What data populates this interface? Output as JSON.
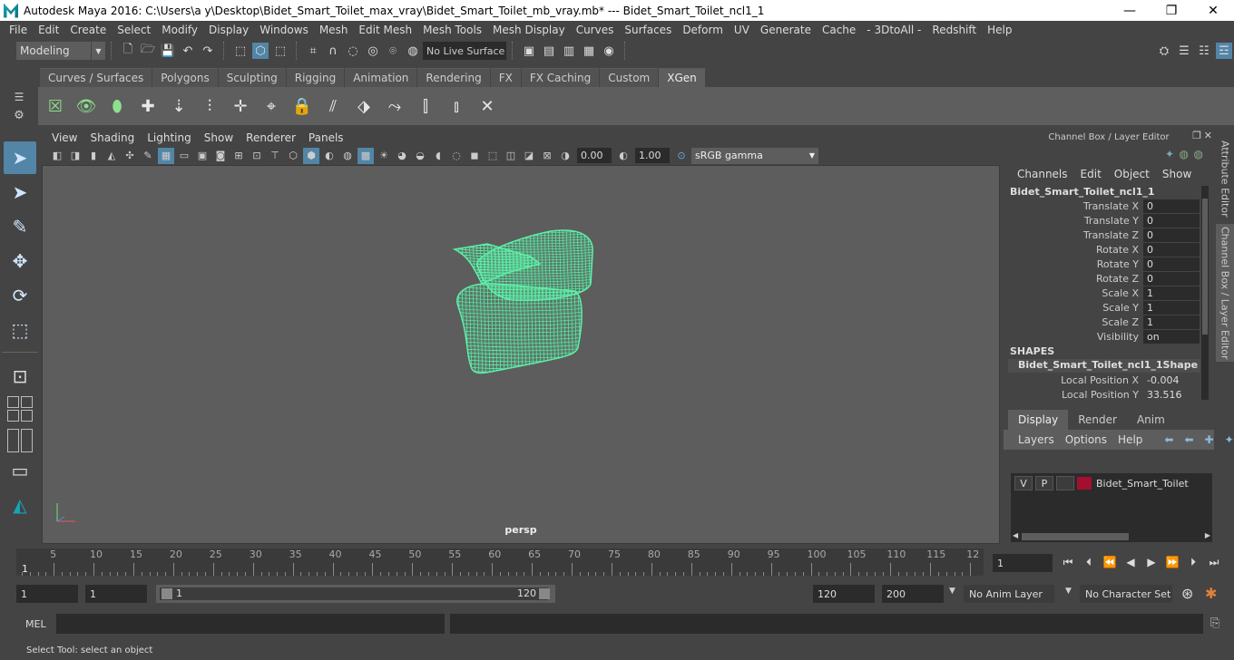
{
  "window": {
    "title": "Autodesk Maya 2016: C:\\Users\\a y\\Desktop\\Bidet_Smart_Toilet_max_vray\\Bidet_Smart_Toilet_mb_vray.mb*   ---   Bidet_Smart_Toilet_ncl1_1",
    "minimize": "—",
    "maximize": "❐",
    "close": "✕"
  },
  "menubar": [
    "File",
    "Edit",
    "Create",
    "Select",
    "Modify",
    "Display",
    "Windows",
    "Mesh",
    "Edit Mesh",
    "Mesh Tools",
    "Mesh Display",
    "Curves",
    "Surfaces",
    "Deform",
    "UV",
    "Generate",
    "Cache",
    "- 3DtoAll -",
    "Redshift",
    "Help"
  ],
  "statusline": {
    "mode": "Modeling",
    "live_surface": "No Live Surface"
  },
  "shelf": {
    "tabs": [
      "Curves / Surfaces",
      "Polygons",
      "Sculpting",
      "Rigging",
      "Animation",
      "Rendering",
      "FX",
      "FX Caching",
      "Custom",
      "XGen"
    ],
    "active_tab": "XGen"
  },
  "viewport": {
    "menu": [
      "View",
      "Shading",
      "Lighting",
      "Show",
      "Renderer",
      "Panels"
    ],
    "exposure": "0.00",
    "gamma": "1.00",
    "color_space": "sRGB gamma",
    "camera": "persp",
    "mesh_color": "#5cf0a8"
  },
  "channel_box": {
    "header": "Channel Box / Layer Editor",
    "menu": [
      "Channels",
      "Edit",
      "Object",
      "Show"
    ],
    "object": "Bidet_Smart_Toilet_ncl1_1",
    "attributes": [
      {
        "label": "Translate X",
        "value": "0"
      },
      {
        "label": "Translate Y",
        "value": "0"
      },
      {
        "label": "Translate Z",
        "value": "0"
      },
      {
        "label": "Rotate X",
        "value": "0"
      },
      {
        "label": "Rotate Y",
        "value": "0"
      },
      {
        "label": "Rotate Z",
        "value": "0"
      },
      {
        "label": "Scale X",
        "value": "1"
      },
      {
        "label": "Scale Y",
        "value": "1"
      },
      {
        "label": "Scale Z",
        "value": "1"
      },
      {
        "label": "Visibility",
        "value": "on"
      }
    ],
    "shapes_header": "SHAPES",
    "shape_name": "Bidet_Smart_Toilet_ncl1_1Shape",
    "shape_attributes": [
      {
        "label": "Local Position X",
        "value": "-0.004"
      },
      {
        "label": "Local Position Y",
        "value": "33.516"
      }
    ]
  },
  "side_tabs": {
    "attribute_editor": "Attribute Editor",
    "channel_box": "Channel Box / Layer Editor"
  },
  "layer_editor": {
    "tabs": [
      "Display",
      "Render",
      "Anim"
    ],
    "active_tab": "Display",
    "menu": [
      "Layers",
      "Options",
      "Help"
    ],
    "layer": {
      "v": "V",
      "p": "P",
      "name": "Bidet_Smart_Toilet",
      "color": "#a3102f"
    }
  },
  "timeline": {
    "ticks": [
      "5",
      "10",
      "15",
      "20",
      "25",
      "30",
      "35",
      "40",
      "45",
      "50",
      "55",
      "60",
      "65",
      "70",
      "75",
      "80",
      "85",
      "90",
      "95",
      "100",
      "105",
      "110",
      "115",
      "12"
    ],
    "first_frame": "1",
    "current_frame": "1"
  },
  "range": {
    "start": "1",
    "playback_start": "1",
    "slider_start": "1",
    "slider_end": "120",
    "playback_end": "120",
    "end": "200",
    "anim_layer": "No Anim Layer",
    "character_set": "No Character Set"
  },
  "command": {
    "label": "MEL"
  },
  "help_line": "Select Tool: select an object"
}
